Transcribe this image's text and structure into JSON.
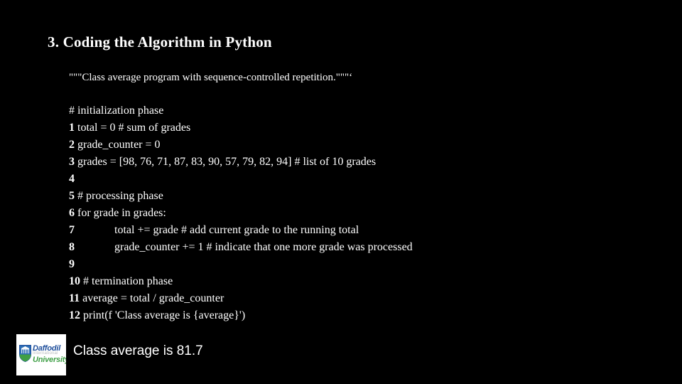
{
  "slide": {
    "background_color": "#000000",
    "text_color": "#ffffff",
    "title": "3. Coding the Algorithm in Python",
    "docstring": "\"\"\"Class average program with sequence-controlled repetition.\"\"\"‘",
    "code": [
      {
        "number": "",
        "text": "# initialization phase",
        "indent": false
      },
      {
        "number": "1",
        "text": "total = 0 # sum of grades",
        "indent": false
      },
      {
        "number": "2",
        "text": "grade_counter = 0",
        "indent": false
      },
      {
        "number": "3",
        "text": "grades = [98, 76, 71, 87, 83, 90, 57, 79, 82, 94] # list of 10 grades",
        "indent": false
      },
      {
        "number": "4",
        "text": "",
        "indent": false
      },
      {
        "number": "5",
        "text": "# processing phase",
        "indent": false
      },
      {
        "number": "6",
        "text": "for grade in grades:",
        "indent": false
      },
      {
        "number": "7",
        "text": "total += grade # add current grade to the running total",
        "indent": true
      },
      {
        "number": "8",
        "text": "grade_counter += 1 # indicate that one more grade was processed",
        "indent": true
      },
      {
        "number": "9",
        "text": "",
        "indent": false
      },
      {
        "number": "10",
        "text": "# termination phase",
        "indent": false
      },
      {
        "number": "11",
        "text": "average = total / grade_counter",
        "indent": false
      },
      {
        "number": "12",
        "text": "print(f 'Class average is {average}')",
        "indent": false
      }
    ],
    "output": "Class average is 81.7"
  },
  "logo": {
    "name": "daffodil-international-university-logo",
    "line1": "Daffodil",
    "line2": "International",
    "line3": "University",
    "color_blue": "#1f4f9c",
    "color_gray": "#b9bcbe",
    "color_green": "#3f9f46",
    "plate_color": "#ffffff"
  }
}
